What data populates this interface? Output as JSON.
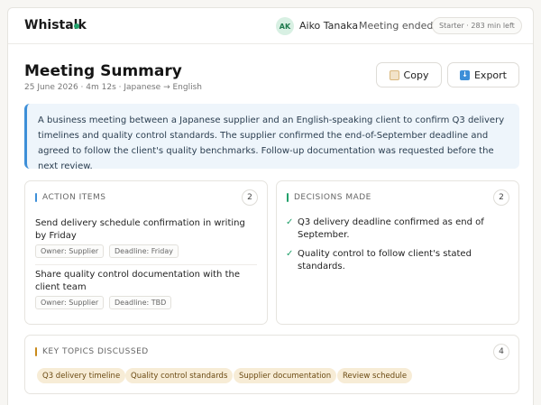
{
  "header": {
    "app_name": "Whistalk",
    "avatar_initials": "AK",
    "user_name": "Aiko Tanaka",
    "meeting_status": "Meeting ended",
    "plan": "Starter · 283 min left",
    "status_color": "#22a06b"
  },
  "page": {
    "title": "Meeting Summary",
    "meta": "25 June 2026 · 4m 12s · Japanese → English",
    "copy_label": "Copy",
    "export_label": "Export",
    "copy_icon": "clipboard-icon",
    "export_icon": "download-icon"
  },
  "summary": {
    "text": "A business meeting between a Japanese supplier and an English-speaking client to confirm Q3 delivery timelines and quality control standards. The supplier confirmed the end-of-September deadline and agreed to follow the client's quality benchmarks. Follow-up documentation was requested before the next review."
  },
  "action_items": {
    "heading": "ACTION ITEMS",
    "count": "2",
    "accent": "#3d8fd8",
    "items": [
      {
        "title": "Send delivery schedule confirmation in writing by Friday",
        "owner": "Owner: Supplier",
        "deadline": "Deadline: Friday"
      },
      {
        "title": "Share quality control documentation with the client team",
        "owner": "Owner: Supplier",
        "deadline": "Deadline: TBD"
      }
    ]
  },
  "decisions": {
    "heading": "DECISIONS MADE",
    "count": "2",
    "accent": "#22a06b",
    "items": [
      "Q3 delivery deadline confirmed as end of September.",
      "Quality control to follow client's stated standards."
    ]
  },
  "topics": {
    "heading": "KEY TOPICS DISCUSSED",
    "count": "4",
    "accent": "#c98a1b",
    "items": [
      "Q3 delivery timeline",
      "Quality control standards",
      "Supplier documentation",
      "Review schedule"
    ]
  }
}
